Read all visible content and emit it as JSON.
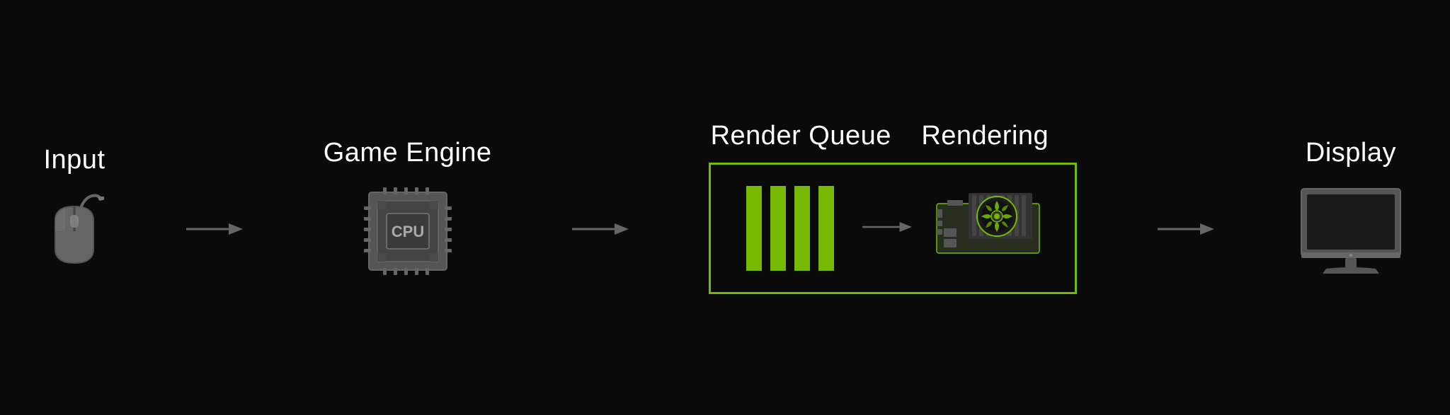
{
  "pipeline": {
    "stages": [
      {
        "id": "input",
        "label": "Input"
      },
      {
        "id": "game-engine",
        "label": "Game Engine"
      },
      {
        "id": "render-queue",
        "label": "Render Queue"
      },
      {
        "id": "rendering",
        "label": "Rendering"
      },
      {
        "id": "display",
        "label": "Display"
      }
    ],
    "colors": {
      "background": "#0a0a0a",
      "text": "#ffffff",
      "accent": "#76b900",
      "icon-gray": "#888888",
      "icon-dark-gray": "#555555"
    }
  }
}
